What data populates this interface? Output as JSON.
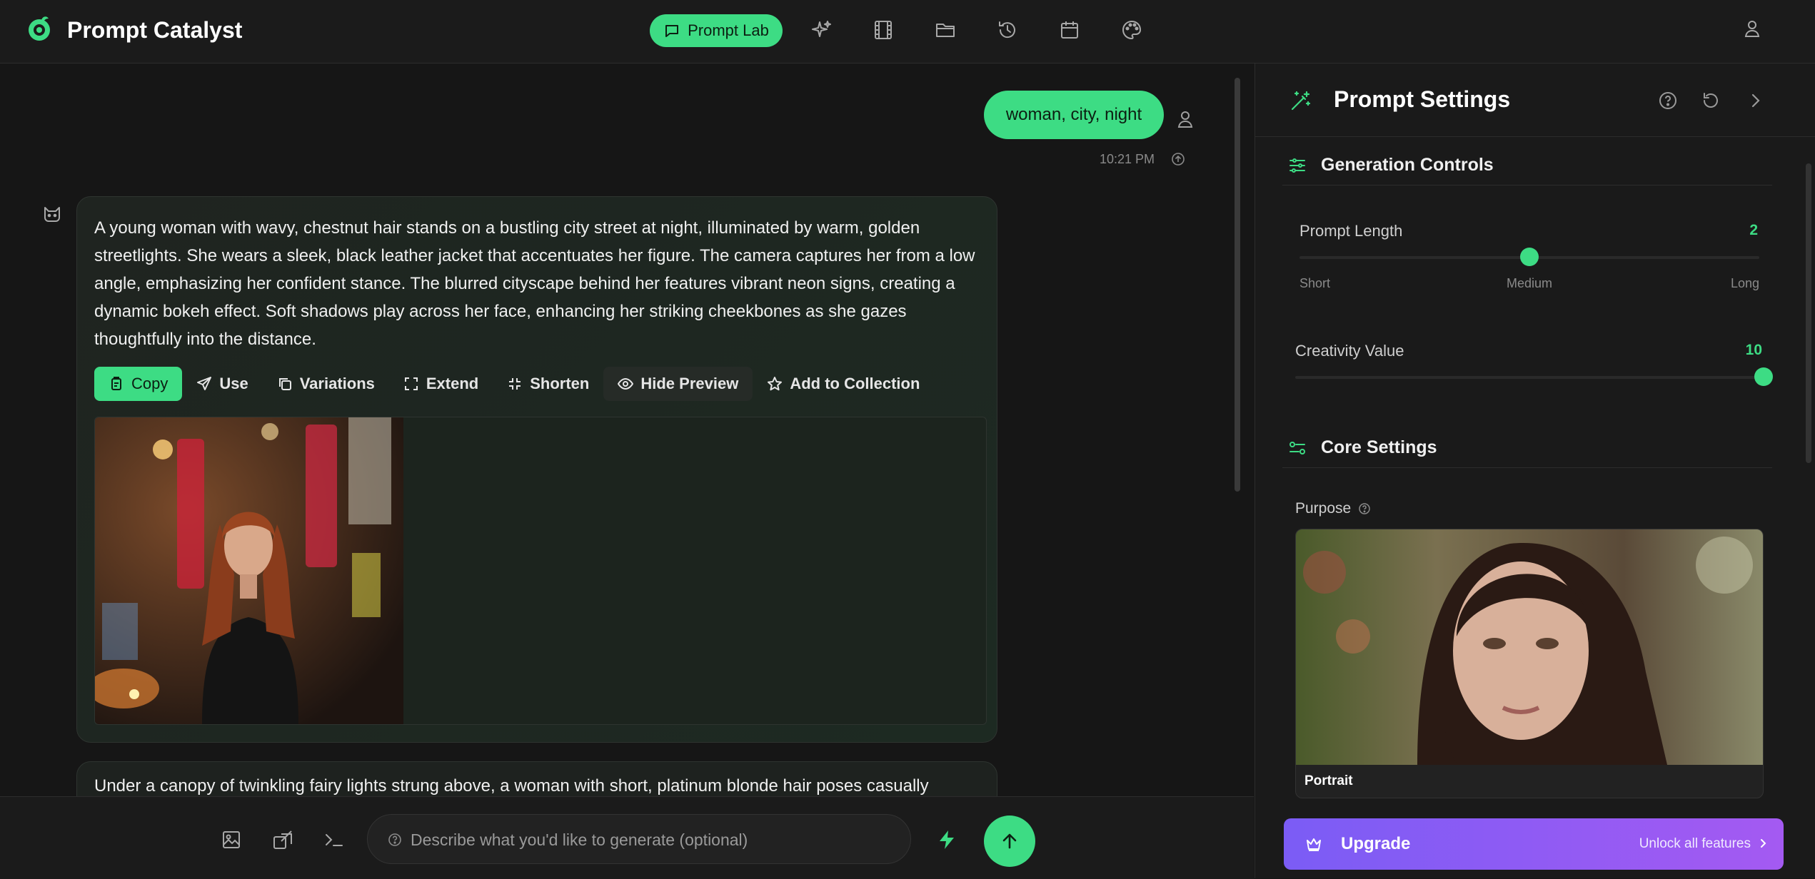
{
  "app": {
    "title": "Prompt Catalyst"
  },
  "nav": {
    "active_label": "Prompt Lab",
    "icons": [
      "sparkles-icon",
      "film-icon",
      "folder-icon",
      "history-icon",
      "calendar-icon",
      "palette-icon",
      "user-icon"
    ]
  },
  "chat": {
    "user_message": "woman, city, night",
    "time": "10:21 PM",
    "response_text": "A young woman with wavy, chestnut hair stands on a bustling city street at night, illuminated by warm, golden streetlights. She wears a sleek, black leather jacket that accentuates her figure. The camera captures her from a low angle, emphasizing her confident stance. The blurred cityscape behind her features vibrant neon signs, creating a dynamic bokeh effect. Soft shadows play across her face, enhancing her striking cheekbones as she gazes thoughtfully into the distance.",
    "actions": {
      "copy": "Copy",
      "use": "Use",
      "variations": "Variations",
      "extend": "Extend",
      "shorten": "Shorten",
      "hide_preview": "Hide Preview",
      "add_to_collection": "Add to Collection"
    },
    "next_response_text": "Under a canopy of twinkling fairy lights strung above, a woman with short, platinum blonde hair poses casually"
  },
  "composer": {
    "placeholder": "Describe what you'd like to generate (optional)"
  },
  "settings": {
    "title": "Prompt Settings",
    "generation_controls": {
      "title": "Generation Controls",
      "prompt_length": {
        "label": "Prompt Length",
        "value": "2",
        "fraction": 0.5,
        "ticks": [
          "Short",
          "Medium",
          "Long"
        ]
      },
      "creativity": {
        "label": "Creativity Value",
        "value": "10",
        "fraction": 1.0
      }
    },
    "core_settings": {
      "title": "Core Settings",
      "purpose_label": "Purpose",
      "purpose_option": "Portrait"
    }
  },
  "upgrade": {
    "label": "Upgrade",
    "sub": "Unlock all features"
  },
  "colors": {
    "accent": "#3ddc84",
    "background": "#161616",
    "panel": "#1a1a1a",
    "upgrade_start": "#7b5cf5",
    "upgrade_end": "#a45af2"
  }
}
